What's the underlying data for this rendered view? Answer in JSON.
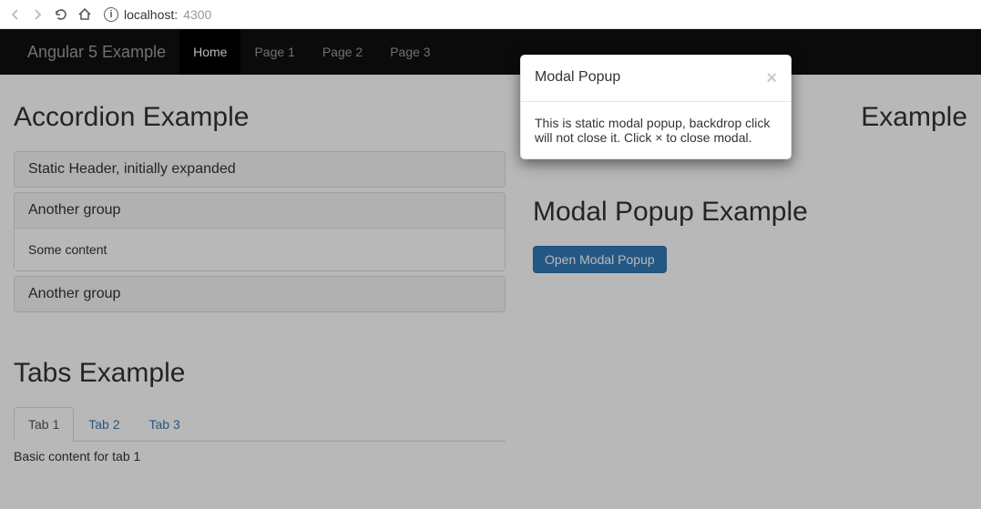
{
  "browser": {
    "url_host": "localhost:",
    "url_port": "4300"
  },
  "navbar": {
    "brand": "Angular 5 Example",
    "items": [
      {
        "label": "Home",
        "active": true
      },
      {
        "label": "Page 1",
        "active": false
      },
      {
        "label": "Page 2",
        "active": false
      },
      {
        "label": "Page 3",
        "active": false
      }
    ]
  },
  "accordion": {
    "heading": "Accordion Example",
    "panels": [
      {
        "header": "Static Header, initially expanded",
        "body": null
      },
      {
        "header": "Another group",
        "body": "Some content"
      },
      {
        "header": "Another group",
        "body": null
      }
    ]
  },
  "tabs_section": {
    "heading": "Tabs Example",
    "tabs": [
      {
        "label": "Tab 1",
        "active": true
      },
      {
        "label": "Tab 2",
        "active": false
      },
      {
        "label": "Tab 3",
        "active": false
      }
    ],
    "content": "Basic content for tab 1"
  },
  "right_col": {
    "example_heading_suffix": "Example",
    "modal_heading": "Modal Popup Example",
    "open_modal_button": "Open Modal Popup"
  },
  "modal": {
    "title": "Modal Popup",
    "body": "This is static modal popup, backdrop click will not close it. Click × to close modal.",
    "close_glyph": "×"
  }
}
